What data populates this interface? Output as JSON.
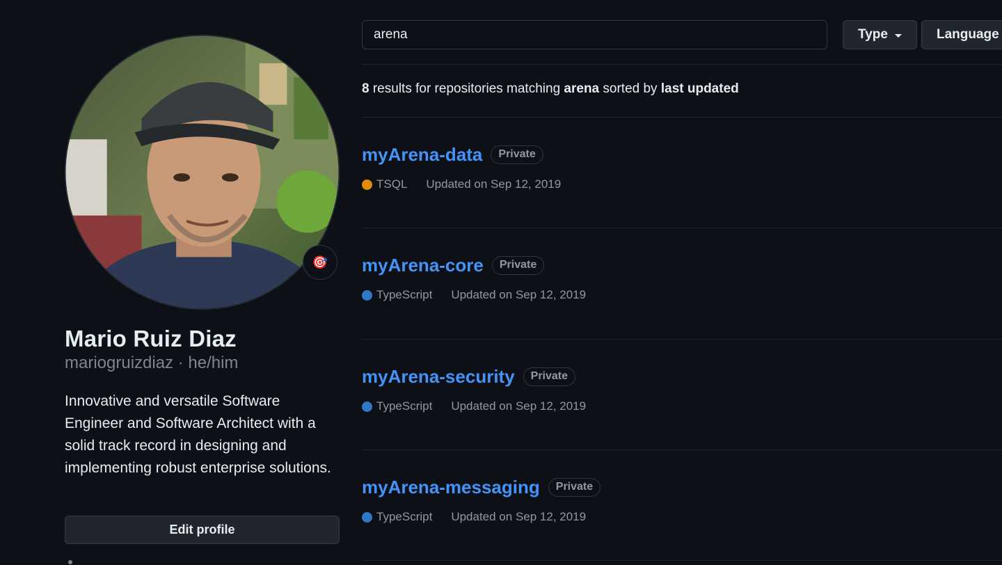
{
  "profile": {
    "full_name": "Mario Ruiz Diaz",
    "login": "mariogruizdiaz",
    "pronouns": "he/him",
    "login_line": "mariogruizdiaz · he/him",
    "bio": "Innovative and versatile Software Engineer and Software Architect with a solid track record in designing and implementing robust enterprise solutions.",
    "status_emoji": "🎯",
    "edit_profile_label": "Edit profile"
  },
  "search": {
    "value": "arena"
  },
  "filters": {
    "type_label": "Type",
    "language_label": "Language"
  },
  "summary": {
    "count": "8",
    "text1": " results for repositories matching ",
    "query": "arena",
    "text2": " sorted by ",
    "sort": "last updated"
  },
  "repos": [
    {
      "name": "myArena-data",
      "visibility": "Private",
      "language": "TSQL",
      "language_color": "#e38c00",
      "updated": "Updated on Sep 12, 2019"
    },
    {
      "name": "myArena-core",
      "visibility": "Private",
      "language": "TypeScript",
      "language_color": "#3178c6",
      "updated": "Updated on Sep 12, 2019"
    },
    {
      "name": "myArena-security",
      "visibility": "Private",
      "language": "TypeScript",
      "language_color": "#3178c6",
      "updated": "Updated on Sep 12, 2019"
    },
    {
      "name": "myArena-messaging",
      "visibility": "Private",
      "language": "TypeScript",
      "language_color": "#3178c6",
      "updated": "Updated on Sep 12, 2019"
    }
  ],
  "colors": {
    "background": "#0d1117",
    "link": "#4493f8",
    "muted": "#9198a1",
    "border": "#30363d"
  }
}
